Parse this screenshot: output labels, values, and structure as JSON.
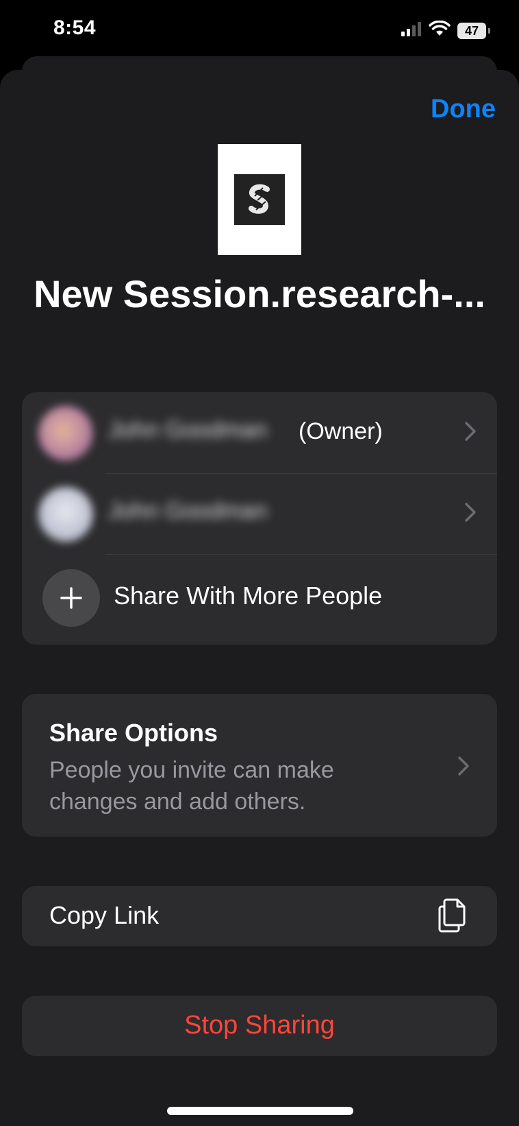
{
  "status_bar": {
    "time": "8:54",
    "battery": "47",
    "icons": [
      "cellular-signal-icon",
      "wifi-icon",
      "battery-icon"
    ]
  },
  "header": {
    "done_label": "Done",
    "document_title": "New Session.research-..."
  },
  "participants": [
    {
      "name": "John Goodman",
      "role": "(Owner)",
      "avatar_color": "#c48fa0"
    },
    {
      "name": "John Goodman",
      "role": "",
      "avatar_color": "#c4c7d4"
    }
  ],
  "share_more": {
    "label": "Share With More People",
    "icon": "plus-icon"
  },
  "share_options": {
    "title": "Share Options",
    "description": "People you invite can make changes and add others."
  },
  "copy_link": {
    "label": "Copy Link",
    "icon": "copy-icon"
  },
  "stop_sharing": {
    "label": "Stop Sharing",
    "color": "#ff453a"
  },
  "colors": {
    "accent": "#0a84ff",
    "sheet_background": "#1c1c1e",
    "card_background": "#2c2c2e",
    "destructive": "#ff453a"
  }
}
